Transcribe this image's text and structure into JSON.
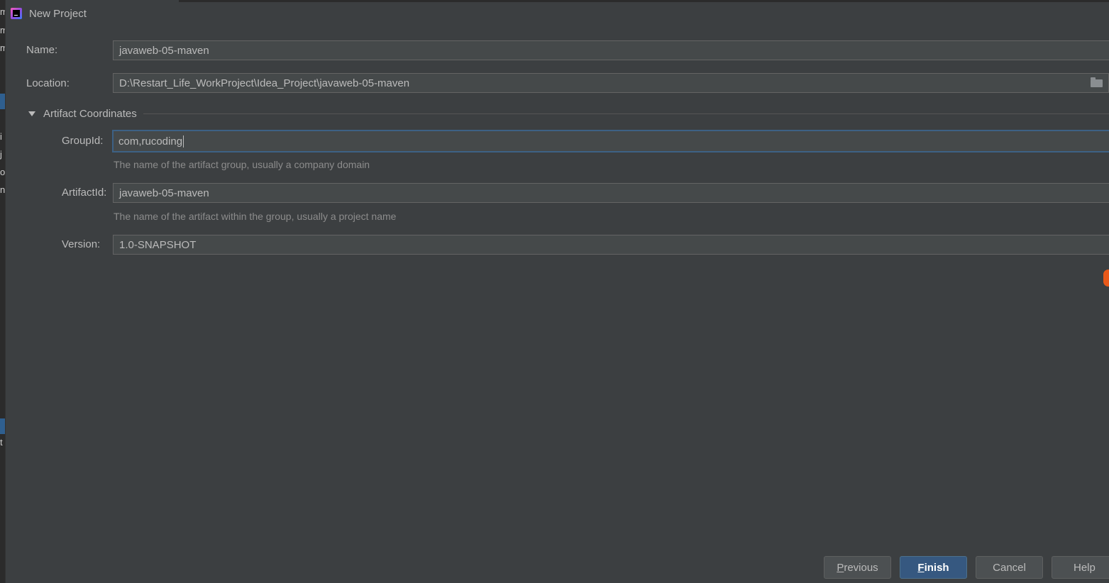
{
  "window": {
    "title": "New Project"
  },
  "form": {
    "name": {
      "label": "Name:",
      "value": "javaweb-05-maven"
    },
    "location": {
      "label": "Location:",
      "value": "D:\\Restart_Life_WorkProject\\Idea_Project\\javaweb-05-maven"
    },
    "artifact_section": {
      "label": "Artifact Coordinates",
      "expanded": true
    },
    "group_id": {
      "label": "GroupId:",
      "value": "com,rucoding",
      "hint": "The name of the artifact group, usually a company domain"
    },
    "artifact_id": {
      "label": "ArtifactId:",
      "value": "javaweb-05-maven",
      "hint": "The name of the artifact within the group, usually a project name"
    },
    "version": {
      "label": "Version:",
      "value": "1.0-SNAPSHOT"
    }
  },
  "buttons": {
    "previous": {
      "mnemonic": "P",
      "rest": "revious"
    },
    "finish": {
      "mnemonic": "F",
      "rest": "inish"
    },
    "cancel": "Cancel",
    "help": "Help"
  },
  "colors": {
    "background": "#3c3f41",
    "field_background": "#45494a",
    "focus_border": "#3d6185",
    "primary_button": "#365880",
    "hint_text": "#8c8c8c"
  },
  "icons": {
    "app": "intellij-idea-icon",
    "browse": "folder-icon",
    "expand": "triangle-down-icon"
  }
}
